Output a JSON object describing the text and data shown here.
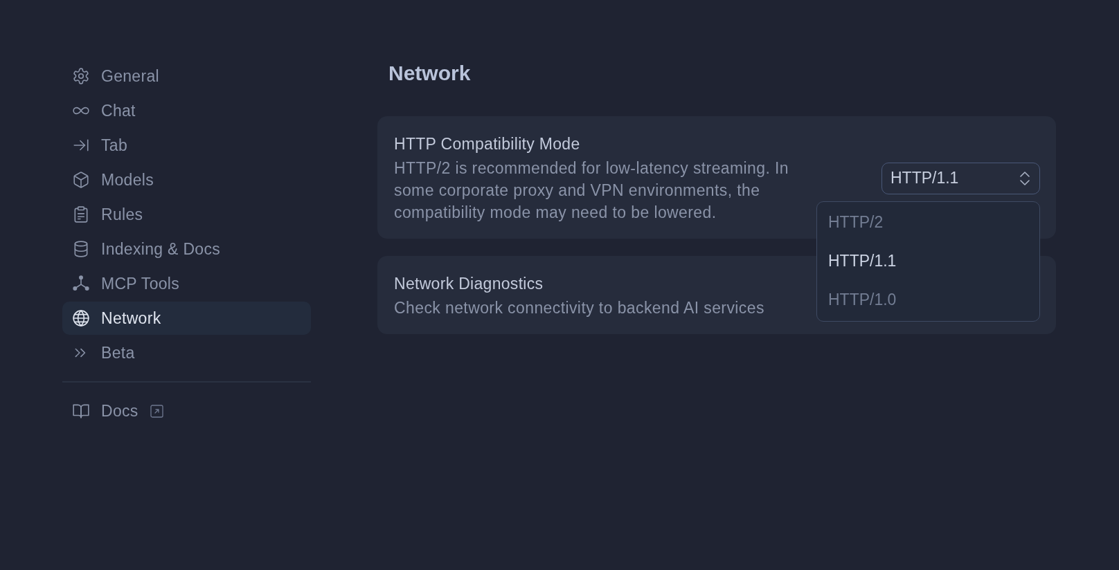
{
  "sidebar": {
    "items": [
      {
        "label": "General",
        "selected": false
      },
      {
        "label": "Chat",
        "selected": false
      },
      {
        "label": "Tab",
        "selected": false
      },
      {
        "label": "Models",
        "selected": false
      },
      {
        "label": "Rules",
        "selected": false
      },
      {
        "label": "Indexing & Docs",
        "selected": false
      },
      {
        "label": "MCP Tools",
        "selected": false
      },
      {
        "label": "Network",
        "selected": true
      },
      {
        "label": "Beta",
        "selected": false
      }
    ],
    "links": [
      {
        "label": "Docs",
        "external": true
      }
    ]
  },
  "page": {
    "title": "Network"
  },
  "settings": [
    {
      "title": "HTTP Compatibility Mode",
      "description": "HTTP/2 is recommended for low-latency streaming. In some corporate proxy and VPN environments, the compatibility mode may need to be lowered.",
      "control": {
        "kind": "select",
        "value": "HTTP/1.1",
        "expanded": true,
        "options": [
          {
            "label": "HTTP/2",
            "selected": false
          },
          {
            "label": "HTTP/1.1",
            "selected": true
          },
          {
            "label": "HTTP/1.0",
            "selected": false
          }
        ]
      }
    },
    {
      "title": "Network Diagnostics",
      "description": "Check network connectivity to backend AI services"
    }
  ]
}
